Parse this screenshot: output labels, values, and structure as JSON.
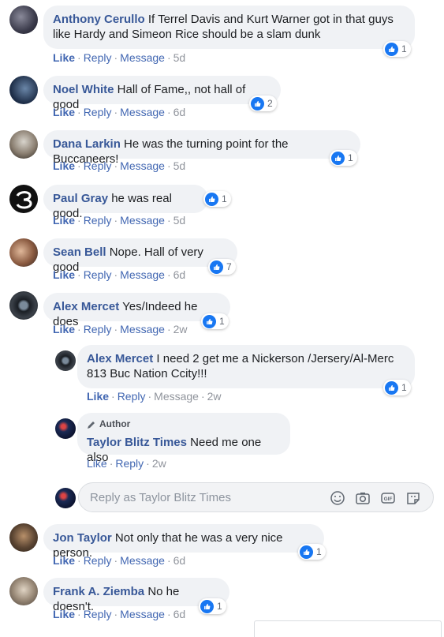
{
  "comments": [
    {
      "author": "Anthony Cerullo",
      "text": "If Terrel Davis and Kurt Warner got in that guys like Hardy and Simeon Rice should be a slam dunk",
      "actions": {
        "like": "Like",
        "reply": "Reply",
        "message": "Message",
        "time": "5d"
      },
      "likes": "1"
    },
    {
      "author": "Noel White",
      "text": "Hall of Fame,, not hall of good",
      "actions": {
        "like": "Like",
        "reply": "Reply",
        "message": "Message",
        "time": "6d"
      },
      "likes": "2"
    },
    {
      "author": "Dana Larkin",
      "text": "He was the turning point for the Buccaneers!",
      "actions": {
        "like": "Like",
        "reply": "Reply",
        "message": "Message",
        "time": "5d"
      },
      "likes": "1"
    },
    {
      "author": "Paul Gray",
      "text": "he was real good.",
      "actions": {
        "like": "Like",
        "reply": "Reply",
        "message": "Message",
        "time": "5d"
      },
      "likes": "1"
    },
    {
      "author": "Sean Bell",
      "text": "Nope. Hall of very good",
      "actions": {
        "like": "Like",
        "reply": "Reply",
        "message": "Message",
        "time": "6d"
      },
      "likes": "7"
    },
    {
      "author": "Alex Mercet",
      "text": "Yes/Indeed he does",
      "actions": {
        "like": "Like",
        "reply": "Reply",
        "message": "Message",
        "time": "2w"
      },
      "likes": "1"
    }
  ],
  "replies": [
    {
      "author": "Alex Mercet",
      "text": "I need 2 get me a Nickerson /Jersery/Al-Merc 813 Buc Nation Ccity!!!",
      "actions": {
        "like": "Like",
        "reply": "Reply",
        "message": "Message",
        "time": "2w"
      },
      "likes": "1"
    },
    {
      "tag": "Author",
      "author": "Taylor Blitz Times",
      "text": "Need me one also",
      "actions": {
        "like": "Like",
        "reply": "Reply",
        "time": "2w"
      }
    }
  ],
  "reply_box": {
    "placeholder": "Reply as Taylor Blitz Times"
  },
  "later_comments": [
    {
      "author": "Jon Taylor",
      "text": "Not only that he was a very nice person.",
      "actions": {
        "like": "Like",
        "reply": "Reply",
        "message": "Message",
        "time": "6d"
      },
      "likes": "1"
    },
    {
      "author": "Frank A. Ziemba",
      "text": "No he doesn't.",
      "actions": {
        "like": "Like",
        "reply": "Reply",
        "message": "Message",
        "time": "6d"
      },
      "likes": "1"
    }
  ],
  "colors": {
    "author": "#385898",
    "like_blue": "#1877f2",
    "bubble": "#f0f2f5",
    "meta": "#90949c"
  }
}
